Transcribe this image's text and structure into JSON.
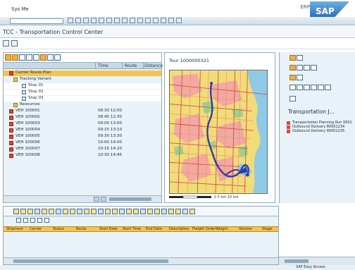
{
  "window": {
    "menu_text": "Sys Me",
    "logo_badge": "ERP"
  },
  "title": "TCC - Transportation Control Center",
  "tree": {
    "columns": [
      "",
      "Time",
      "Route",
      "Distance"
    ],
    "rows": [
      {
        "name": "Carrier Route Plan",
        "val": "",
        "indent": 8,
        "sel": true,
        "ico": "red"
      },
      {
        "name": "Tracking Variant",
        "val": "",
        "indent": 14,
        "sel": false,
        "ico": "yel"
      },
      {
        "name": "Stop 01",
        "val": "",
        "indent": 26,
        "sel": false,
        "ico": "blue",
        "white": true
      },
      {
        "name": "Stop 02",
        "val": "",
        "indent": 26,
        "sel": false,
        "ico": "blue",
        "white": true
      },
      {
        "name": "Stop 03",
        "val": "",
        "indent": 26,
        "sel": false,
        "ico": "blue",
        "white": true
      },
      {
        "name": "Resources",
        "val": "",
        "indent": 14,
        "sel": false,
        "ico": "yel"
      },
      {
        "name": "VEH 100001",
        "val": "08:30  12:00",
        "indent": 8,
        "sel": false,
        "ico": "red"
      },
      {
        "name": "VEH 100002",
        "val": "08:45  12:30",
        "indent": 8,
        "sel": false,
        "ico": "red"
      },
      {
        "name": "VEH 100003",
        "val": "09:00  13:00",
        "indent": 8,
        "sel": false,
        "ico": "red"
      },
      {
        "name": "VEH 100004",
        "val": "09:15  13:10",
        "indent": 8,
        "sel": false,
        "ico": "red"
      },
      {
        "name": "VEH 100005",
        "val": "09:30  13:30",
        "indent": 8,
        "sel": false,
        "ico": "red"
      },
      {
        "name": "VEH 100006",
        "val": "10:00  14:00",
        "indent": 8,
        "sel": false,
        "ico": "red"
      },
      {
        "name": "VEH 100007",
        "val": "10:15  14:20",
        "indent": 8,
        "sel": false,
        "ico": "red"
      },
      {
        "name": "VEH 100008",
        "val": "10:30  14:45",
        "indent": 8,
        "sel": false,
        "ico": "red"
      }
    ]
  },
  "map": {
    "title": "Tour 1000000321",
    "scale": "0    5 km    10 km"
  },
  "right": {
    "section_title": "Transportation J...",
    "items": [
      "Transportation Planning Run 0001",
      "Outbound Delivery 80001234",
      "Outbound Delivery 80001235"
    ]
  },
  "bottom": {
    "header_cols": [
      "Shipment",
      "Carrier",
      "Status",
      "Route",
      "Start Date",
      "Start Time",
      "End Date",
      "Description",
      "Freight Order",
      "Weight",
      "Volume",
      "Stage"
    ]
  },
  "status": {
    "text": "SAP Easy Access"
  },
  "colors": {
    "accent": "#f7c44a",
    "panel": "#e9f2f8",
    "border": "#8fa9bd",
    "route": "#2f3e9e"
  }
}
